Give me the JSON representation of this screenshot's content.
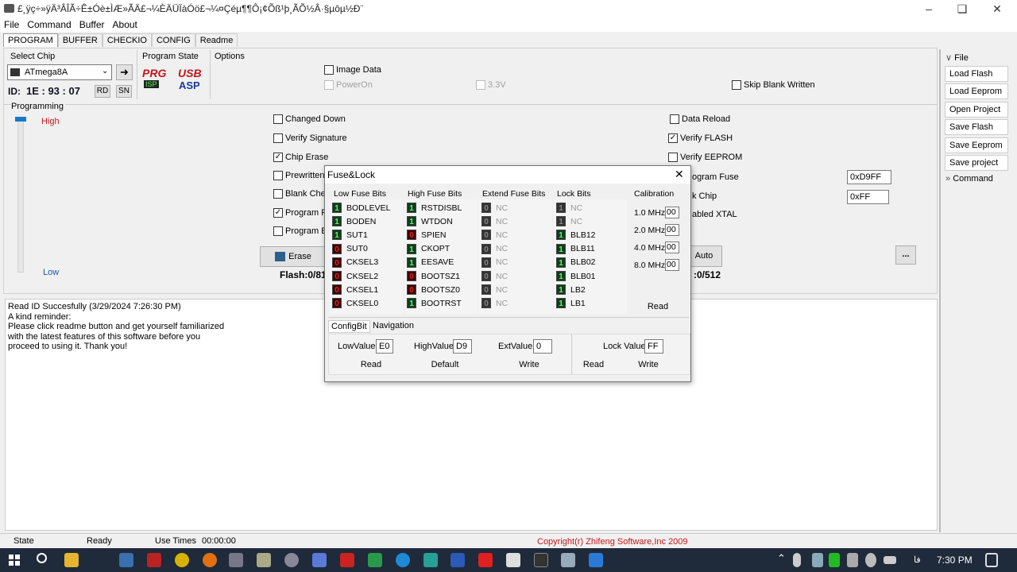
{
  "window": {
    "title": "£¸ÿç÷»ÿ­Ä³ÂÎÃ÷Ê±Óè±ÌÆ­»ÃÄ£¬¼ÈÄÜÏàÓö£¬¼¤Çéµ¶¶Ô¡¢Õß¹þ¸ÃÕ½Â·§µôµ½Ð¨"
  },
  "menu": [
    "File",
    "Command",
    "Buffer",
    "About"
  ],
  "tabs": [
    "PROGRAM",
    "BUFFER",
    "CHECKIO",
    "CONFIG",
    "Readme"
  ],
  "select_chip": {
    "label": "Select Chip",
    "value": "ATmega8A",
    "id_label": "ID:",
    "id_value": "1E : 93 : 07",
    "rd": "RD",
    "sn": "SN"
  },
  "program_state": {
    "label": "Program State",
    "prg": "PRG",
    "isp": "ISP",
    "usb": "USB",
    "asp": "ASP"
  },
  "options": {
    "label": "Options",
    "image_data": "Image Data",
    "power_on": "PowerOn",
    "voltage": "3.3V",
    "skip_blank": "Skip Blank Written"
  },
  "programming": {
    "label": "Programming",
    "high": "High",
    "low": "Low"
  },
  "checks": {
    "changed_down": "Changed Down",
    "verify_signature": "Verify Signature",
    "chip_erase": "Chip Erase",
    "prewritten": "Prewritten F",
    "blank_check": "Blank Check",
    "program_fl": "Program FL",
    "program_ee": "Program EE",
    "data_reload": "Data Reload",
    "verify_flash": "Verify FLASH",
    "verify_eeprom": "Verify EEPROM",
    "program_fuse": "ogram Fuse",
    "lock_chip": "k Chip",
    "xtal": "abled XTAL"
  },
  "fuse_value": "0xD9FF",
  "lock_value": "0xFF",
  "erase_button": "Erase",
  "auto_button": "Auto",
  "more_button": "...",
  "flash_info": "Flash:0/81",
  "eeprom_info": ":0/512",
  "sidebar": {
    "file_header": "File",
    "items": [
      "Load Flash",
      "Load Eeprom",
      "Open Project",
      "Save Flash",
      "Save Eeprom",
      "Save project"
    ],
    "command_header": "Command"
  },
  "log": [
    "Read ID Succesfully (3/29/2024 7:26:30 PM)",
    "A kind reminder:",
    "Please click readme button and get yourself familiarized",
    "with the latest features of this software beforе you",
    "proceed to using it. Thank you!"
  ],
  "status": {
    "state": "State",
    "ready": "Ready",
    "use_times": "Use Times",
    "time": "00:00:00",
    "copyright": "Copyright(r) Zhifeng Software,Inc 2009"
  },
  "dialog": {
    "title": "Fuse&Lock",
    "low_header": "Low Fuse Bits",
    "high_header": "High Fuse Bits",
    "ext_header": "Extend Fuse Bits",
    "lock_header": "Lock Bits",
    "cal_header": "Calibration",
    "low_bits": [
      {
        "v": "1",
        "n": "BODLEVEL"
      },
      {
        "v": "1",
        "n": "BODEN"
      },
      {
        "v": "1",
        "n": "SUT1"
      },
      {
        "v": "0",
        "n": "SUT0"
      },
      {
        "v": "0",
        "n": "CKSEL3"
      },
      {
        "v": "0",
        "n": "CKSEL2"
      },
      {
        "v": "0",
        "n": "CKSEL1"
      },
      {
        "v": "0",
        "n": "CKSEL0"
      }
    ],
    "high_bits": [
      {
        "v": "1",
        "n": "RSTDISBL"
      },
      {
        "v": "1",
        "n": "WTDON"
      },
      {
        "v": "0",
        "n": "SPIEN"
      },
      {
        "v": "1",
        "n": "CKOPT"
      },
      {
        "v": "1",
        "n": "EESAVE"
      },
      {
        "v": "0",
        "n": "BOOTSZ1"
      },
      {
        "v": "0",
        "n": "BOOTSZ0"
      },
      {
        "v": "1",
        "n": "BOOTRST"
      }
    ],
    "ext_bits": [
      {
        "v": "0",
        "n": "NC"
      },
      {
        "v": "0",
        "n": "NC"
      },
      {
        "v": "0",
        "n": "NC"
      },
      {
        "v": "0",
        "n": "NC"
      },
      {
        "v": "0",
        "n": "NC"
      },
      {
        "v": "0",
        "n": "NC"
      },
      {
        "v": "0",
        "n": "NC"
      },
      {
        "v": "0",
        "n": "NC"
      }
    ],
    "lock_bits": [
      {
        "v": "1",
        "n": "NC"
      },
      {
        "v": "1",
        "n": "NC"
      },
      {
        "v": "1",
        "n": "BLB12"
      },
      {
        "v": "1",
        "n": "BLB11"
      },
      {
        "v": "1",
        "n": "BLB02"
      },
      {
        "v": "1",
        "n": "BLB01"
      },
      {
        "v": "1",
        "n": "LB2"
      },
      {
        "v": "1",
        "n": "LB1"
      }
    ],
    "calibration": [
      {
        "f": "1.0 MHz",
        "v": "00"
      },
      {
        "f": "2.0 MHz",
        "v": "00"
      },
      {
        "f": "4.0 MHz",
        "v": "00"
      },
      {
        "f": "8.0 MHz",
        "v": "00"
      }
    ],
    "cal_read": "Read",
    "tabs": [
      "ConfigBit",
      "Navigation"
    ],
    "low_value_label": "LowValue",
    "low_value": "E0",
    "high_value_label": "HighValue",
    "high_value": "D9",
    "ext_value_label": "ExtValue",
    "ext_value": "0",
    "lock_value_label": "Lock Value",
    "lock_value": "FF",
    "read": "Read",
    "default": "Default",
    "write": "Write",
    "lock_read": "Read",
    "lock_write": "Write"
  },
  "taskbar": {
    "time": "7:30 PM",
    "lang": "فا"
  }
}
